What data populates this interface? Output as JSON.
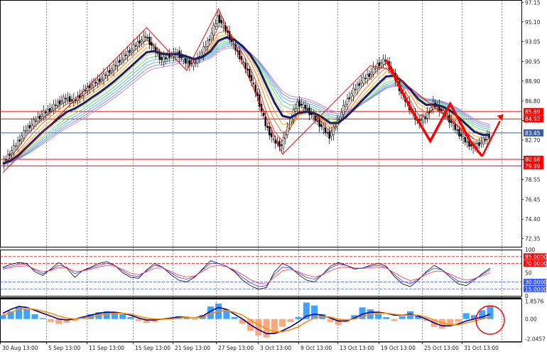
{
  "chart_data": {
    "type": "line",
    "instrument_panel": "price",
    "price_axis": {
      "ticks": [
        97.15,
        95.1,
        93.05,
        90.95,
        88.9,
        86.8,
        84.75,
        82.7,
        80.65,
        78.55,
        76.45,
        74.4,
        72.35
      ],
      "ylim": [
        71.5,
        97.4
      ]
    },
    "time_axis": {
      "labels": [
        "30 Aug 13:00",
        "5 Sep 13:00",
        "11 Sep 13:00",
        "15 Sep 13:00",
        "21 Sep 13:00",
        "27 Sep 13:00",
        "3 Oct 13:00",
        "9 Oct 13:00",
        "13 Oct 13:00",
        "19 Oct 13:00",
        "25 Oct 13:00",
        "31 Oct 13:00"
      ]
    },
    "horizontal_levels": [
      {
        "value": 85.69,
        "label": "85.69",
        "color": "#ff0000"
      },
      {
        "value": 84.92,
        "label": "84.92",
        "color": "#ff0000"
      },
      {
        "value": 83.45,
        "label": "83.45",
        "color": "#3a5fa8"
      },
      {
        "value": 80.68,
        "label": "80.68",
        "color": "#ff0000"
      },
      {
        "value": 79.99,
        "label": "79.99",
        "color": "#ff0000"
      }
    ],
    "price_series": [
      80.2,
      81.3,
      82.5,
      83.8,
      84.6,
      85.4,
      85.9,
      86.6,
      87.1,
      86.8,
      87.6,
      88.4,
      88.9,
      89.6,
      90.4,
      91.3,
      92.1,
      92.9,
      93.6,
      92.3,
      91.1,
      91.6,
      91.8,
      90.9,
      90.6,
      91.9,
      93.4,
      95.6,
      94.3,
      92.6,
      91.1,
      89.5,
      87.2,
      84.3,
      82.6,
      82.1,
      84.6,
      86.6,
      86.1,
      85.1,
      84.1,
      83.1,
      84.6,
      86.6,
      87.9,
      88.9,
      89.6,
      90.6,
      91.1,
      89.6,
      87.6,
      86.1,
      84.6,
      85.1,
      86.5,
      85.8,
      84.8,
      83.6,
      82.6,
      81.9,
      82.5,
      83.2
    ],
    "moving_averages": {
      "ribbon_colors": [
        "#ff2a00",
        "#ff6a00",
        "#ffa000",
        "#e0d000",
        "#a8e040",
        "#60d080",
        "#40c0c0",
        "#60a0e0",
        "#8080e0",
        "#c080d0"
      ],
      "slow_ma_color": "#1c1c6e"
    },
    "annotations": {
      "zigzag_color": "#ff0000",
      "arrow_color": "#ff0000"
    },
    "oscillator_panel": {
      "ticks": [
        "100",
        "85.0000",
        "70.0000",
        "50",
        "30.0000",
        "15.0000",
        "0"
      ],
      "levels": [
        {
          "value": 85,
          "color": "#ff0000"
        },
        {
          "value": 70,
          "color": "#ff0000"
        },
        {
          "value": 30,
          "color": "#3355ff"
        },
        {
          "value": 15,
          "color": "#3355ff"
        }
      ],
      "series": [
        {
          "color": "#000000",
          "values": [
            62,
            68,
            72,
            70,
            52,
            44,
            58,
            72,
            60,
            40,
            55,
            62,
            70,
            74,
            66,
            50,
            40,
            38,
            56,
            70,
            62,
            46,
            34,
            30,
            40,
            58,
            76,
            70,
            64,
            52,
            34,
            22,
            14,
            18,
            52,
            70,
            62,
            46,
            34,
            30,
            46,
            64,
            72,
            66,
            58,
            60,
            66,
            70,
            64,
            42,
            26,
            20,
            34,
            52,
            66,
            56,
            40,
            26,
            22,
            34,
            48,
            60
          ]
        },
        {
          "color": "#3333ff",
          "values": [
            60,
            64,
            68,
            68,
            56,
            48,
            56,
            66,
            62,
            48,
            54,
            60,
            66,
            70,
            66,
            54,
            44,
            42,
            54,
            66,
            62,
            50,
            40,
            36,
            42,
            56,
            70,
            70,
            64,
            54,
            40,
            28,
            20,
            22,
            46,
            62,
            60,
            50,
            40,
            36,
            46,
            60,
            68,
            66,
            60,
            60,
            64,
            66,
            62,
            46,
            32,
            26,
            36,
            50,
            60,
            56,
            44,
            32,
            28,
            36,
            46,
            56
          ]
        },
        {
          "color": "#ff3333",
          "values": [
            58,
            61,
            64,
            65,
            58,
            52,
            55,
            61,
            61,
            53,
            54,
            58,
            62,
            66,
            64,
            57,
            49,
            46,
            52,
            60,
            60,
            53,
            45,
            41,
            43,
            53,
            63,
            66,
            63,
            56,
            46,
            35,
            27,
            26,
            40,
            54,
            57,
            52,
            45,
            41,
            45,
            54,
            61,
            62,
            60,
            59,
            61,
            62,
            60,
            50,
            40,
            33,
            37,
            46,
            53,
            53,
            47,
            39,
            34,
            37,
            43,
            50
          ]
        }
      ]
    },
    "macd_panel": {
      "ticks": [
        "1.8576",
        "0.00",
        "-2.0457"
      ],
      "ylim": [
        -2.3,
        2.1
      ],
      "histogram_colors": {
        "positive": "#1e90ff",
        "negative": "#ff9966"
      },
      "histogram": [
        0.4,
        0.8,
        1.2,
        1.0,
        0.5,
        0.1,
        -0.3,
        -0.5,
        -0.4,
        -0.2,
        0.2,
        0.5,
        0.7,
        0.8,
        0.7,
        0.5,
        0.2,
        -0.2,
        -0.4,
        -0.3,
        -0.1,
        0.1,
        0.3,
        0.2,
        -0.1,
        0.4,
        1.3,
        1.6,
        1.0,
        0.2,
        -0.5,
        -1.2,
        -1.7,
        -1.9,
        -1.5,
        -0.8,
        -0.3,
        0.2,
        1.7,
        1.4,
        0.5,
        -0.3,
        -0.6,
        -0.3,
        0.4,
        1.2,
        1.0,
        0.5,
        0.2,
        -0.2,
        0.3,
        0.8,
        0.4,
        -0.2,
        -0.8,
        -1.0,
        -0.6,
        -0.3,
        0.6,
        0.4,
        0.9,
        1.3
      ],
      "signal_line_colors": [
        "#00008b",
        "#ff8c00"
      ],
      "lines": [
        [
          0.6,
          1.0,
          1.3,
          1.2,
          0.9,
          0.6,
          0.3,
          0.0,
          -0.1,
          0.0,
          0.2,
          0.4,
          0.6,
          0.7,
          0.7,
          0.6,
          0.4,
          0.1,
          -0.1,
          -0.1,
          0.0,
          0.1,
          0.2,
          0.2,
          0.1,
          0.3,
          0.8,
          1.2,
          1.0,
          0.5,
          0.0,
          -0.6,
          -1.1,
          -1.5,
          -1.5,
          -1.2,
          -0.8,
          -0.3,
          0.3,
          0.5,
          0.4,
          0.1,
          -0.2,
          -0.2,
          0.1,
          0.5,
          0.7,
          0.7,
          0.6,
          0.4,
          0.4,
          0.5,
          0.3,
          0.0,
          -0.4,
          -0.7,
          -0.7,
          -0.5,
          -0.2,
          0.0,
          0.2,
          0.5
        ],
        [
          0.4,
          0.7,
          1.0,
          1.1,
          1.0,
          0.8,
          0.6,
          0.3,
          0.1,
          0.0,
          0.1,
          0.2,
          0.4,
          0.5,
          0.6,
          0.6,
          0.5,
          0.3,
          0.1,
          0.0,
          0.0,
          0.0,
          0.1,
          0.2,
          0.1,
          0.2,
          0.5,
          0.8,
          0.9,
          0.7,
          0.4,
          -0.1,
          -0.6,
          -1.0,
          -1.3,
          -1.3,
          -1.1,
          -0.8,
          -0.3,
          0.1,
          0.3,
          0.2,
          0.0,
          -0.1,
          0.0,
          0.2,
          0.5,
          0.6,
          0.6,
          0.5,
          0.4,
          0.4,
          0.4,
          0.2,
          -0.1,
          -0.4,
          -0.6,
          -0.6,
          -0.4,
          -0.2,
          0.0,
          0.2
        ]
      ]
    }
  }
}
